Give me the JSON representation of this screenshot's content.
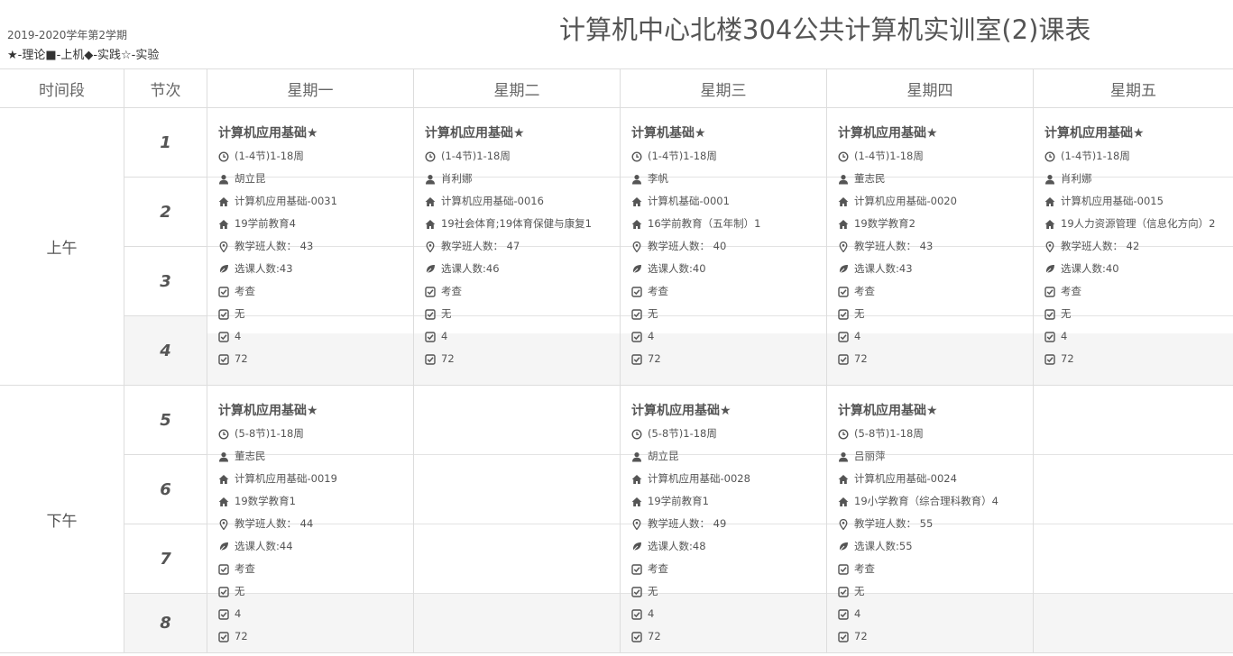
{
  "page": {
    "term": "2019-2020学年第2学期",
    "legend": "★-理论■-上机◆-实践☆-实验",
    "title": "计算机中心北楼304公共计算机实训室(2)课表"
  },
  "header": {
    "time": "时间段",
    "slot": "节次",
    "days": [
      "星期一",
      "星期二",
      "星期三",
      "星期四",
      "星期五"
    ]
  },
  "periods": {
    "am": "上午",
    "pm": "下午"
  },
  "slots": [
    "1",
    "2",
    "3",
    "4",
    "5",
    "6",
    "7",
    "8"
  ],
  "icons": [
    "clock-icon",
    "user-icon",
    "home-icon",
    "map-marker-icon",
    "leaf-icon",
    "check-square-icon"
  ],
  "schedule": {
    "am": [
      {
        "name": "计算机应用基础★",
        "time": "(1-4节)1-18周",
        "teacher": "胡立昆",
        "class": "计算机应用基础-0031",
        "group": "19学前教育4",
        "size": "教学班人数： 43",
        "enrolled": "选课人数:43",
        "exam": "考查",
        "note": "无",
        "weekly": "4",
        "total": "72"
      },
      {
        "name": "计算机应用基础★",
        "time": "(1-4节)1-18周",
        "teacher": "肖利娜",
        "class": "计算机应用基础-0016",
        "group": "19社会体育;19体育保健与康复1",
        "size": "教学班人数： 47",
        "enrolled": "选课人数:46",
        "exam": "考查",
        "note": "无",
        "weekly": "4",
        "total": "72"
      },
      {
        "name": "计算机基础★",
        "time": "(1-4节)1-18周",
        "teacher": "李帆",
        "class": "计算机基础-0001",
        "group": "16学前教育（五年制）1",
        "size": "教学班人数： 40",
        "enrolled": "选课人数:40",
        "exam": "考查",
        "note": "无",
        "weekly": "4",
        "total": "72"
      },
      {
        "name": "计算机应用基础★",
        "time": "(1-4节)1-18周",
        "teacher": "董志民",
        "class": "计算机应用基础-0020",
        "group": "19数学教育2",
        "size": "教学班人数： 43",
        "enrolled": "选课人数:43",
        "exam": "考查",
        "note": "无",
        "weekly": "4",
        "total": "72"
      },
      {
        "name": "计算机应用基础★",
        "time": "(1-4节)1-18周",
        "teacher": "肖利娜",
        "class": "计算机应用基础-0015",
        "group": "19人力资源管理（信息化方向）2",
        "size": "教学班人数： 42",
        "enrolled": "选课人数:40",
        "exam": "考查",
        "note": "无",
        "weekly": "4",
        "total": "72"
      }
    ],
    "pm": [
      {
        "name": "计算机应用基础★",
        "time": "(5-8节)1-18周",
        "teacher": "董志民",
        "class": "计算机应用基础-0019",
        "group": "19数学教育1",
        "size": "教学班人数： 44",
        "enrolled": "选课人数:44",
        "exam": "考查",
        "note": "无",
        "weekly": "4",
        "total": "72"
      },
      null,
      {
        "name": "计算机应用基础★",
        "time": "(5-8节)1-18周",
        "teacher": "胡立昆",
        "class": "计算机应用基础-0028",
        "group": "19学前教育1",
        "size": "教学班人数： 49",
        "enrolled": "选课人数:48",
        "exam": "考查",
        "note": "无",
        "weekly": "4",
        "total": "72"
      },
      {
        "name": "计算机应用基础★",
        "time": "(5-8节)1-18周",
        "teacher": "吕丽萍",
        "class": "计算机应用基础-0024",
        "group": "19小学教育（综合理科教育）4",
        "size": "教学班人数： 55",
        "enrolled": "选课人数:55",
        "exam": "考查",
        "note": "无",
        "weekly": "4",
        "total": "72"
      },
      null
    ]
  }
}
